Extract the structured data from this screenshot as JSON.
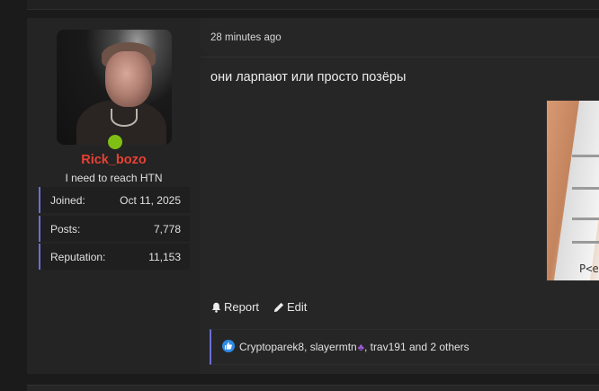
{
  "post": {
    "time": "28 minutes ago",
    "message": "они ларпают или просто позёры",
    "attachment_text": "P<e"
  },
  "user": {
    "username": "Rick_bozo",
    "title": "I need to reach HTN",
    "online": true,
    "stats": [
      {
        "label": "Joined:",
        "value": "Oct 11, 2025"
      },
      {
        "label": "Posts:",
        "value": "7,778"
      },
      {
        "label": "Reputation:",
        "value": "11,153"
      }
    ]
  },
  "actions": {
    "report": "Report",
    "edit": "Edit"
  },
  "reactions": {
    "text_before": "Cryptoparek8, slayermtn",
    "grape_icon": "grape-icon",
    "text_after": ", trav191 and 2 others"
  },
  "colors": {
    "username": "#e64233",
    "accent": "#6a6fd8",
    "online": "#7fbf14",
    "like": "#2f8ae6"
  }
}
